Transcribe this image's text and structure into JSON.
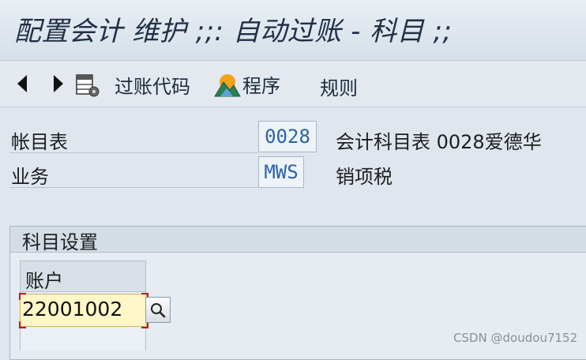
{
  "window": {
    "title": "配置会计 维护 ;;: 自动过账 - 科目 ;;"
  },
  "toolbar": {
    "posting_key_label": "过账代码",
    "procedure_label": "程序",
    "rules_label": "规则"
  },
  "fields": {
    "chart_of_accounts": {
      "label": "帐目表",
      "value": "0028",
      "description": "会计科目表 0028爱德华"
    },
    "transaction": {
      "label": "业务",
      "value": "MWS",
      "description": "销项税"
    }
  },
  "account_assignment": {
    "title": "科目设置",
    "column_header": "账户",
    "rows": [
      {
        "account": "22001002"
      }
    ]
  },
  "watermark": "CSDN @doudou7152"
}
